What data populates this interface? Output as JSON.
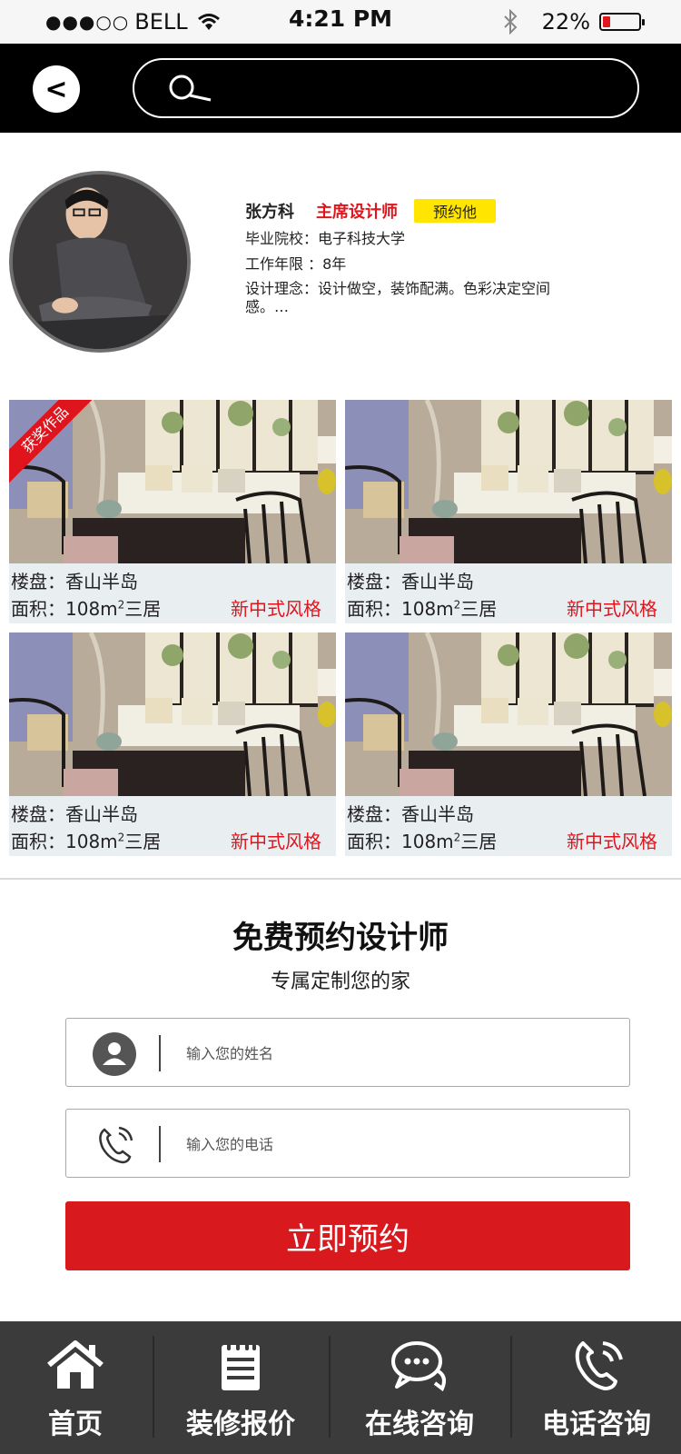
{
  "status_bar": {
    "signal": "●●●○○",
    "carrier": "BELL",
    "time": "4:21 PM",
    "battery": "22%",
    "battery_level": 0.22,
    "battery_color": "#e0141d"
  },
  "nav": {
    "back_label": "<",
    "search_placeholder": ""
  },
  "designer": {
    "name": "张方科",
    "title": "主席设计师",
    "book_label": "预约他",
    "school": "毕业院校：电子科技大学",
    "years": "工作年限 ：8年",
    "philosophy": "设计理念：设计做空，装饰配满。色彩决定空间感。…"
  },
  "gallery": [
    {
      "project": "楼盘：香山半岛",
      "area_prefix": "面积：108m",
      "area_sup": "2",
      "area_suffix": "三居",
      "style": "新中式风格",
      "badge": "获奖作品"
    },
    {
      "project": "楼盘：香山半岛",
      "area_prefix": "面积：108m",
      "area_sup": "2",
      "area_suffix": "三居",
      "style": "新中式风格"
    },
    {
      "project": "楼盘：香山半岛",
      "area_prefix": "面积：108m",
      "area_sup": "2",
      "area_suffix": "三居",
      "style": "新中式风格"
    },
    {
      "project": "楼盘：香山半岛",
      "area_prefix": "面积：108m",
      "area_sup": "2",
      "area_suffix": "三居",
      "style": "新中式风格"
    }
  ],
  "booking": {
    "title": "免费预约设计师",
    "subtitle": "专属定制您的家",
    "name_placeholder": "输入您的姓名",
    "phone_placeholder": "输入您的电话",
    "submit_label": "立即预约"
  },
  "tabs": [
    {
      "label": "首页",
      "icon": "home-icon"
    },
    {
      "label": "装修报价",
      "icon": "notepad-icon"
    },
    {
      "label": "在线咨询",
      "icon": "chat-icon"
    },
    {
      "label": "电话咨询",
      "icon": "phone-icon"
    }
  ],
  "colors": {
    "accent_red": "#e0141d",
    "button_red": "#d81a1f",
    "badge_yellow": "#ffe500",
    "tabbar_bg": "#3b3b3b",
    "nav_bg": "#000000"
  }
}
